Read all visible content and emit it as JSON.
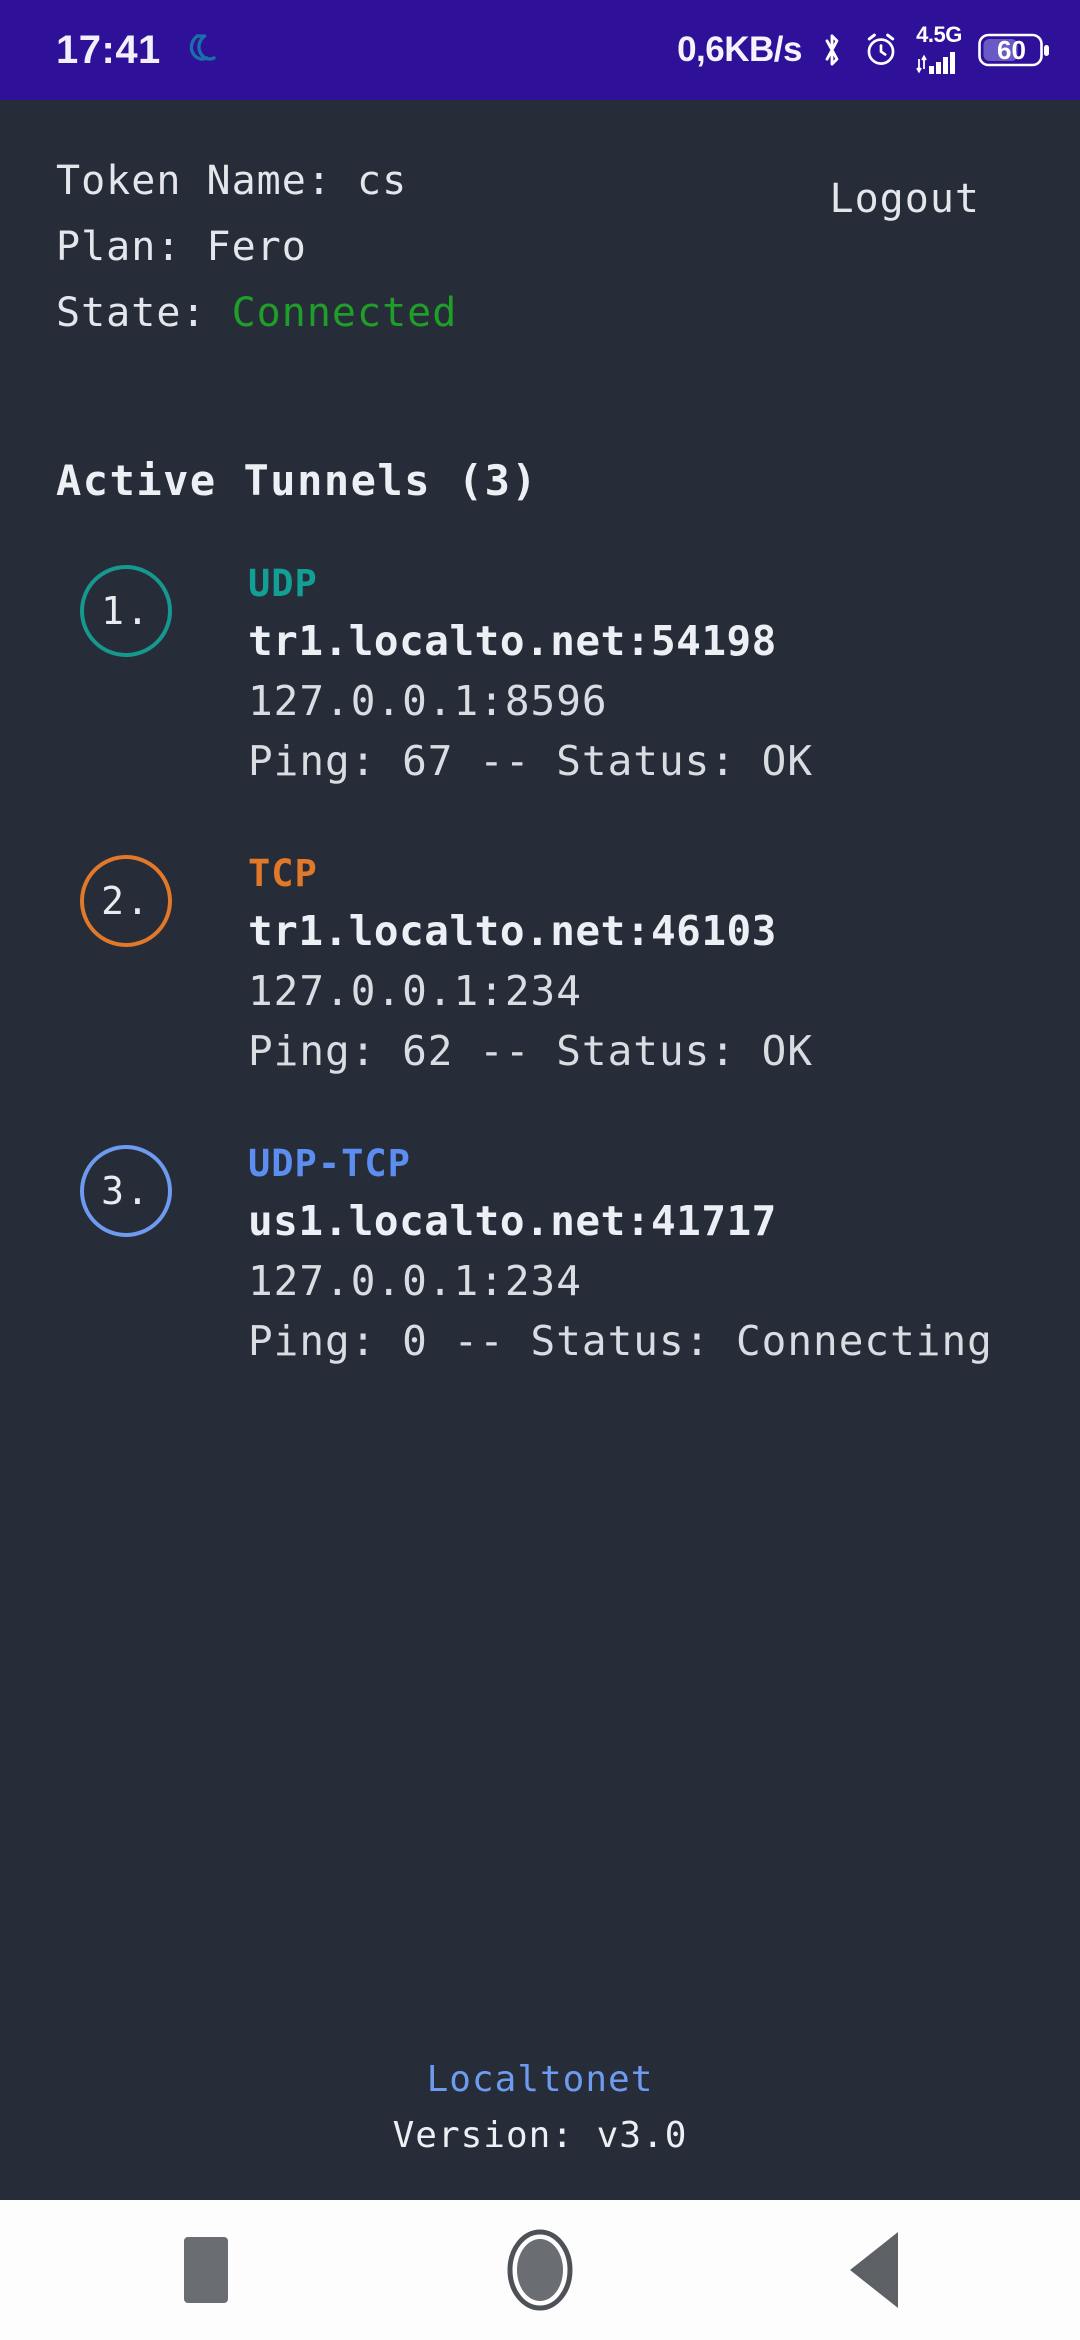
{
  "status_bar": {
    "time": "17:41",
    "app_icon": "localtonet-logo-icon",
    "network_speed": "0,6KB/s",
    "bluetooth_icon": "bluetooth-icon",
    "alarm_icon": "alarm-clock-icon",
    "network_type": "4.5G",
    "signal_icon": "signal-bars-icon",
    "battery_level": "60",
    "bg_color": "#2e1099"
  },
  "account": {
    "token_name_label": "Token Name: cs",
    "plan_label": "Plan: Fero",
    "state_prefix": "State: ",
    "state_value": "Connected",
    "state_color": "#1f9e29",
    "logout_label": "Logout"
  },
  "main": {
    "section_title": "Active Tunnels (3)",
    "tunnels": [
      {
        "index": "1.",
        "protocol": "UDP",
        "color": "#12a096",
        "remote": "tr1.localto.net:54198",
        "local": "127.0.0.1:8596",
        "stats": "Ping: 67 -- Status: OK",
        "ping": "67",
        "status": "OK"
      },
      {
        "index": "2.",
        "protocol": "TCP",
        "color": "#e2782a",
        "remote": "tr1.localto.net:46103",
        "local": "127.0.0.1:234",
        "stats": "Ping: 62 -- Status: OK",
        "ping": "62",
        "status": "OK"
      },
      {
        "index": "3.",
        "protocol": "UDP-TCP",
        "color": "#5b8ef0",
        "remote": "us1.localto.net:41717",
        "local": "127.0.0.1:234",
        "stats": "Ping: 0 -- Status: Connecting",
        "ping": "0",
        "status": "Connecting"
      }
    ]
  },
  "footer": {
    "brand": "Localtonet",
    "brand_color": "#6e9bf0",
    "version": "Version: v3.0"
  },
  "nav_bar": {
    "recents_icon": "square-recents-icon",
    "home_icon": "circle-home-icon",
    "back_icon": "triangle-back-icon",
    "bg_color": "#fdfdfd"
  },
  "theme": {
    "background": "#262d38",
    "text_primary": "#eceff3",
    "text_secondary": "#d9dde2"
  }
}
